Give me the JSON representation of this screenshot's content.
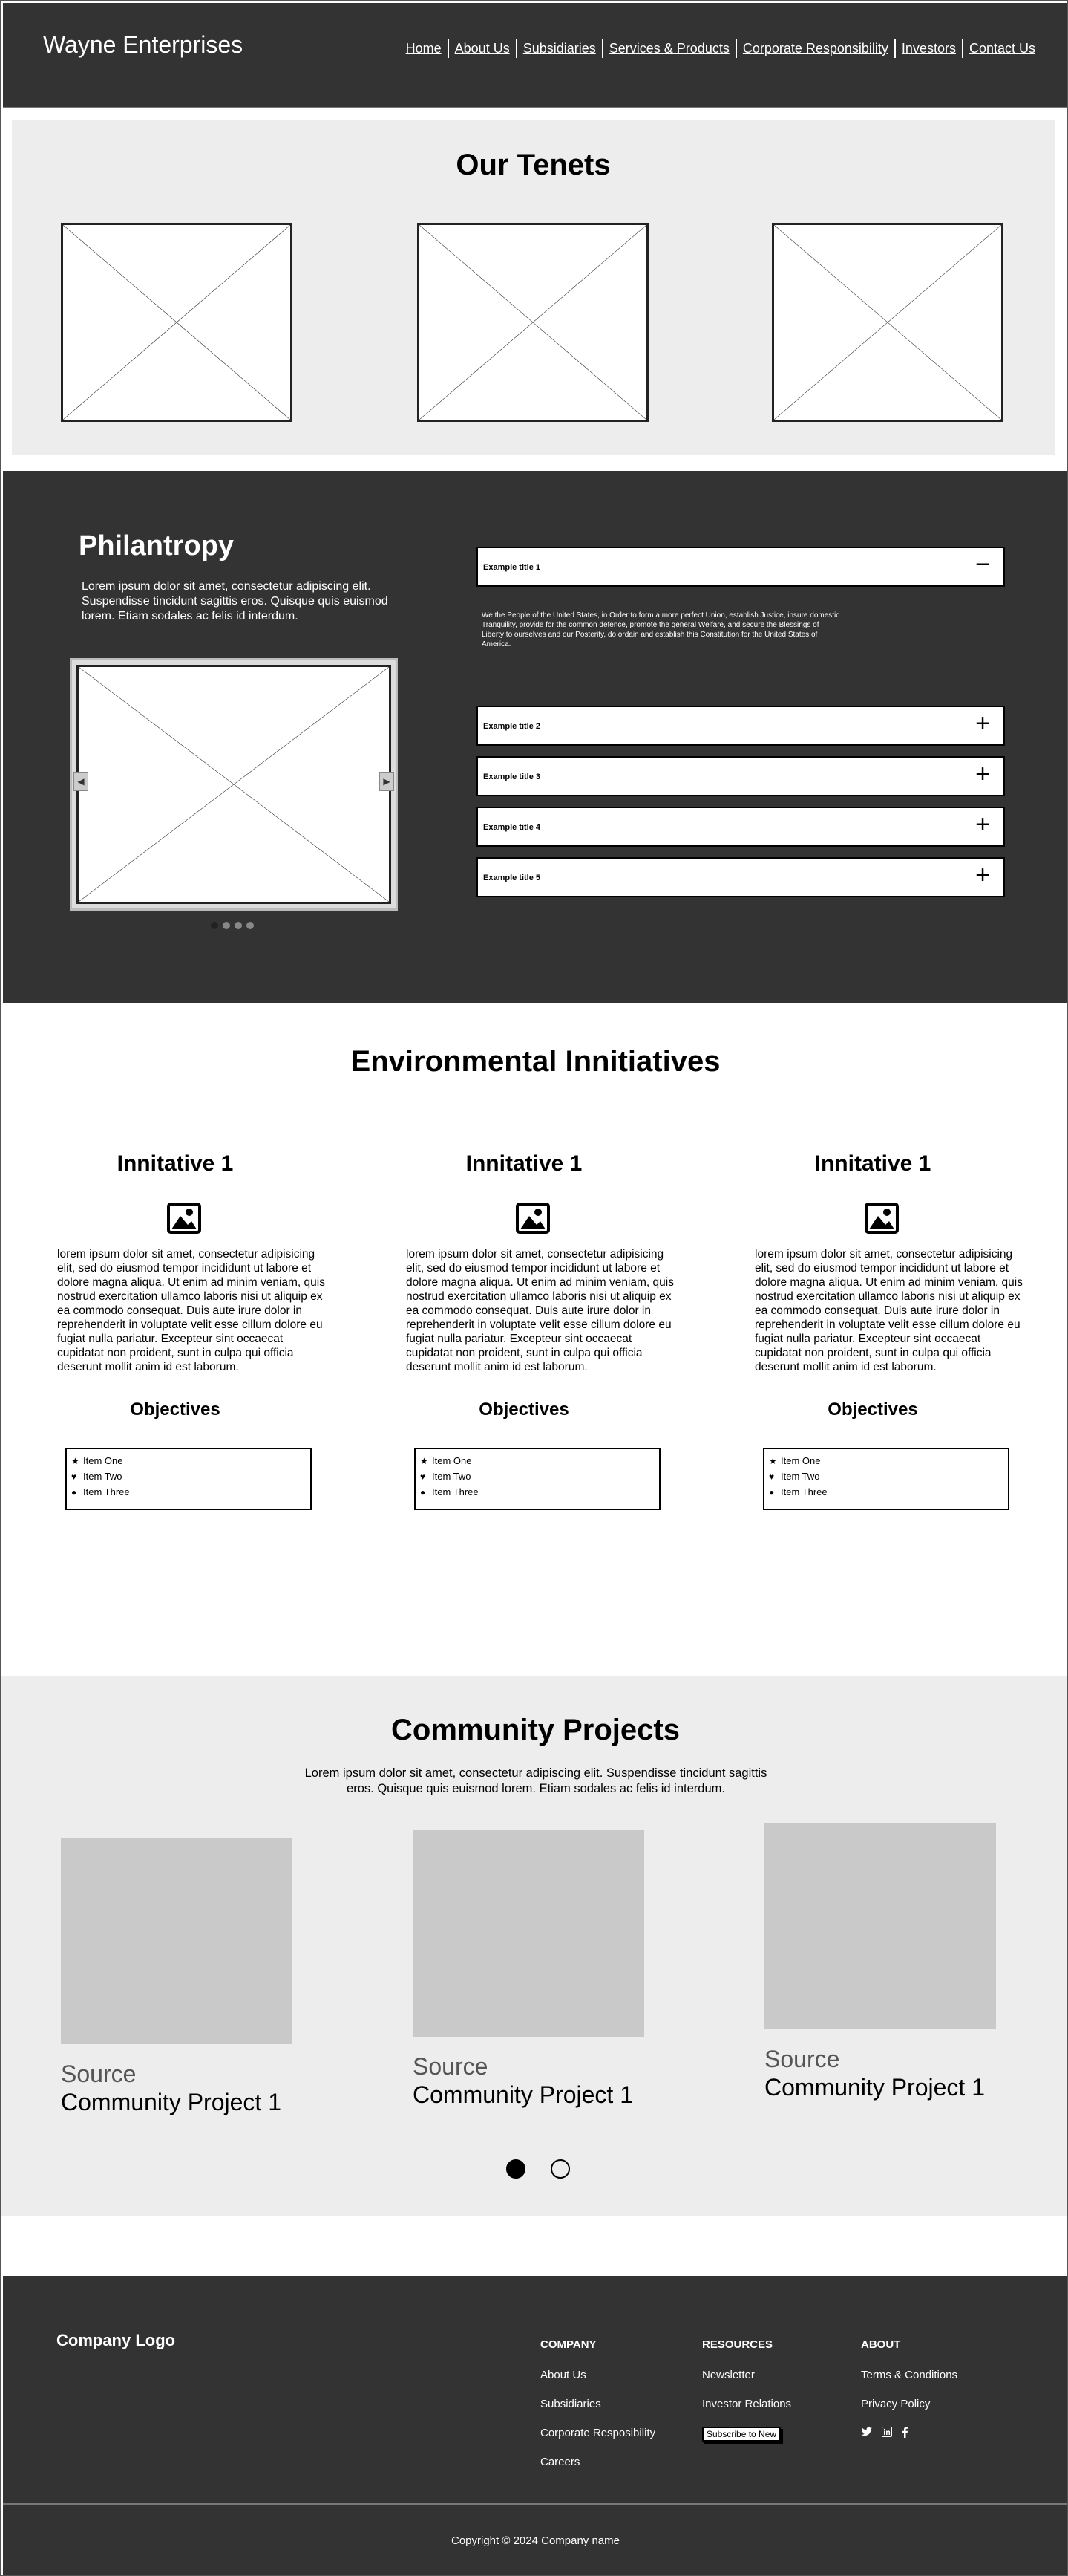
{
  "header": {
    "brand": "Wayne Enterprises",
    "nav": [
      "Home",
      "About Us",
      "Subsidiaries",
      "Services & Products",
      "Corporate Responsibility",
      "Investors",
      "Contact Us"
    ]
  },
  "tenets": {
    "title": "Our Tenets"
  },
  "philantropy": {
    "title": "Philantropy",
    "text": "Lorem ipsum dolor sit amet, consectetur adipiscing elit. Suspendisse tincidunt sagittis eros. Quisque quis euismod lorem. Etiam sodales ac felis id interdum.",
    "carousel": {
      "prev_icon": "chevron-left-icon",
      "next_icon": "chevron-right-icon",
      "slide_count": 4,
      "active_slide": 1
    },
    "accordion": [
      {
        "title": "Example title 1",
        "expanded": true,
        "body": "We the People of the United States, in Order to form a more perfect Union, establish Justice, insure domestic Tranquility, provide for the common defence, promote the general Welfare, and secure the Blessings of Liberty to ourselves and our Posterity, do ordain and establish this Constitution for the United States of America."
      },
      {
        "title": "Example title 2",
        "expanded": false
      },
      {
        "title": "Example title 3",
        "expanded": false
      },
      {
        "title": "Example title 4",
        "expanded": false
      },
      {
        "title": "Example title 5",
        "expanded": false
      }
    ],
    "expanded_sign": "−",
    "collapsed_sign": "+"
  },
  "environmental": {
    "title": "Environmental Innitiatives",
    "columns": [
      {
        "title": "Innitative 1",
        "icon": "image-icon",
        "text": "lorem ipsum dolor sit amet, consectetur adipisicing elit, sed do eiusmod tempor incididunt ut labore et dolore magna aliqua. Ut enim ad minim veniam, quis nostrud exercitation ullamco laboris nisi ut aliquip ex ea commodo consequat. Duis aute irure dolor in reprehenderit in voluptate velit esse cillum dolore eu fugiat nulla pariatur. Excepteur sint occaecat cupidatat non proident, sunt in culpa qui officia deserunt mollit anim id est laborum.",
        "objectives_title": "Objectives",
        "items": [
          {
            "icon": "star-icon",
            "label": "Item One"
          },
          {
            "icon": "heart-icon",
            "label": "Item Two"
          },
          {
            "icon": "circle-icon",
            "label": "Item Three"
          }
        ]
      },
      {
        "title": "Innitative 1",
        "icon": "image-icon",
        "text": "lorem ipsum dolor sit amet, consectetur adipisicing elit, sed do eiusmod tempor incididunt ut labore et dolore magna aliqua. Ut enim ad minim veniam, quis nostrud exercitation ullamco laboris nisi ut aliquip ex ea commodo consequat. Duis aute irure dolor in reprehenderit in voluptate velit esse cillum dolore eu fugiat nulla pariatur. Excepteur sint occaecat cupidatat non proident, sunt in culpa qui officia deserunt mollit anim id est laborum.",
        "objectives_title": "Objectives",
        "items": [
          {
            "icon": "star-icon",
            "label": "Item One"
          },
          {
            "icon": "heart-icon",
            "label": "Item Two"
          },
          {
            "icon": "circle-icon",
            "label": "Item Three"
          }
        ]
      },
      {
        "title": "Innitative 1",
        "icon": "image-icon",
        "text": "lorem ipsum dolor sit amet, consectetur adipisicing elit, sed do eiusmod tempor incididunt ut labore et dolore magna aliqua. Ut enim ad minim veniam, quis nostrud exercitation ullamco laboris nisi ut aliquip ex ea commodo consequat. Duis aute irure dolor in reprehenderit in voluptate velit esse cillum dolore eu fugiat nulla pariatur. Excepteur sint occaecat cupidatat non proident, sunt in culpa qui officia deserunt mollit anim id est laborum.",
        "objectives_title": "Objectives",
        "items": [
          {
            "icon": "star-icon",
            "label": "Item One"
          },
          {
            "icon": "heart-icon",
            "label": "Item Two"
          },
          {
            "icon": "circle-icon",
            "label": "Item Three"
          }
        ]
      }
    ]
  },
  "community": {
    "title": "Community Projects",
    "text": "Lorem ipsum dolor sit amet, consectetur adipiscing elit. Suspendisse tincidunt sagittis eros. Quisque quis euismod lorem. Etiam sodales ac felis id interdum.",
    "cards": [
      {
        "source": "Source",
        "title": "Community Project 1"
      },
      {
        "source": "Source",
        "title": "Community Project 1"
      },
      {
        "source": "Source",
        "title": "Community Project 1"
      }
    ],
    "pages": 2,
    "active_page": 1
  },
  "footer": {
    "logo": "Company Logo",
    "columns": [
      {
        "heading": "COMPANY",
        "links": [
          "About Us",
          "Subsidiaries",
          "Corporate Resposibility",
          "Careers"
        ]
      },
      {
        "heading": "RESOURCES",
        "links": [
          "Newsletter",
          "Investor Relations"
        ],
        "button": "Subscribe to New"
      },
      {
        "heading": "ABOUT",
        "links": [
          "Terms & Conditions",
          "Privacy Policy"
        ],
        "socials": [
          "twitter-icon",
          "linkedin-icon",
          "facebook-icon"
        ]
      }
    ],
    "copyright": "Copyright © 2024 Company name"
  },
  "colors": {
    "dark": "#333333",
    "light_gray": "#ededed",
    "card_gray": "#c9c9c9",
    "white": "#ffffff"
  }
}
